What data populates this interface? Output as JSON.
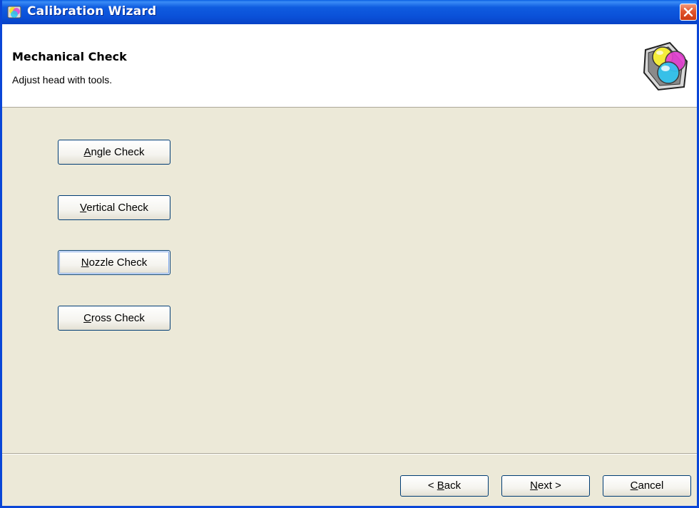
{
  "window": {
    "title": "Calibration Wizard",
    "close_label": "Close"
  },
  "header": {
    "title": "Mechanical Check",
    "subtitle": "Adjust head with tools.",
    "icon": "calibration-color-icon"
  },
  "tools": [
    {
      "mnemonic": "A",
      "rest": "ngle Check"
    },
    {
      "mnemonic": "V",
      "rest": "ertical Check"
    },
    {
      "mnemonic": "N",
      "rest": "ozzle Check"
    },
    {
      "mnemonic": "C",
      "rest": "ross Check"
    }
  ],
  "footer": {
    "back": {
      "prefix": "< ",
      "mnemonic": "B",
      "rest": "ack"
    },
    "next": {
      "mnemonic": "N",
      "rest": "ext >"
    },
    "cancel": {
      "mnemonic": "C",
      "rest": "ancel"
    }
  },
  "colors": {
    "titlebar": "#0a50d8",
    "dialog_bg": "#ece9d8",
    "button_border": "#003c74"
  }
}
